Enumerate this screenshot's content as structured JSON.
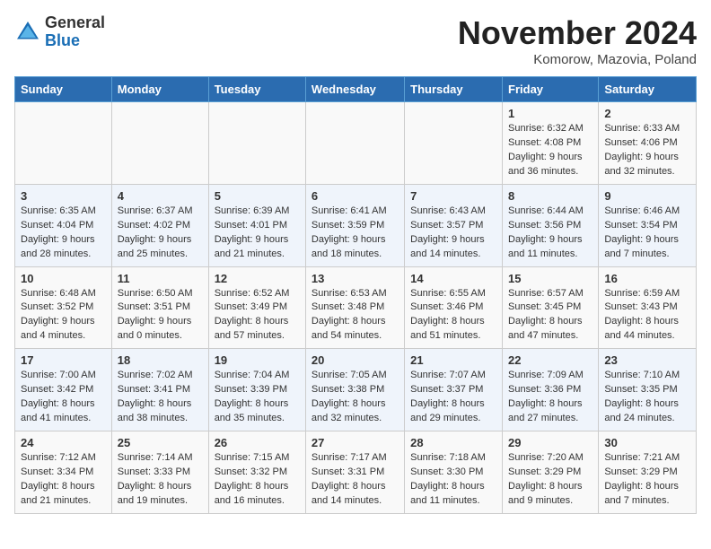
{
  "header": {
    "logo_general": "General",
    "logo_blue": "Blue",
    "month_title": "November 2024",
    "location": "Komorow, Mazovia, Poland"
  },
  "weekdays": [
    "Sunday",
    "Monday",
    "Tuesday",
    "Wednesday",
    "Thursday",
    "Friday",
    "Saturday"
  ],
  "rows": [
    [
      {
        "day": "",
        "info": ""
      },
      {
        "day": "",
        "info": ""
      },
      {
        "day": "",
        "info": ""
      },
      {
        "day": "",
        "info": ""
      },
      {
        "day": "",
        "info": ""
      },
      {
        "day": "1",
        "info": "Sunrise: 6:32 AM\nSunset: 4:08 PM\nDaylight: 9 hours and 36 minutes."
      },
      {
        "day": "2",
        "info": "Sunrise: 6:33 AM\nSunset: 4:06 PM\nDaylight: 9 hours and 32 minutes."
      }
    ],
    [
      {
        "day": "3",
        "info": "Sunrise: 6:35 AM\nSunset: 4:04 PM\nDaylight: 9 hours and 28 minutes."
      },
      {
        "day": "4",
        "info": "Sunrise: 6:37 AM\nSunset: 4:02 PM\nDaylight: 9 hours and 25 minutes."
      },
      {
        "day": "5",
        "info": "Sunrise: 6:39 AM\nSunset: 4:01 PM\nDaylight: 9 hours and 21 minutes."
      },
      {
        "day": "6",
        "info": "Sunrise: 6:41 AM\nSunset: 3:59 PM\nDaylight: 9 hours and 18 minutes."
      },
      {
        "day": "7",
        "info": "Sunrise: 6:43 AM\nSunset: 3:57 PM\nDaylight: 9 hours and 14 minutes."
      },
      {
        "day": "8",
        "info": "Sunrise: 6:44 AM\nSunset: 3:56 PM\nDaylight: 9 hours and 11 minutes."
      },
      {
        "day": "9",
        "info": "Sunrise: 6:46 AM\nSunset: 3:54 PM\nDaylight: 9 hours and 7 minutes."
      }
    ],
    [
      {
        "day": "10",
        "info": "Sunrise: 6:48 AM\nSunset: 3:52 PM\nDaylight: 9 hours and 4 minutes."
      },
      {
        "day": "11",
        "info": "Sunrise: 6:50 AM\nSunset: 3:51 PM\nDaylight: 9 hours and 0 minutes."
      },
      {
        "day": "12",
        "info": "Sunrise: 6:52 AM\nSunset: 3:49 PM\nDaylight: 8 hours and 57 minutes."
      },
      {
        "day": "13",
        "info": "Sunrise: 6:53 AM\nSunset: 3:48 PM\nDaylight: 8 hours and 54 minutes."
      },
      {
        "day": "14",
        "info": "Sunrise: 6:55 AM\nSunset: 3:46 PM\nDaylight: 8 hours and 51 minutes."
      },
      {
        "day": "15",
        "info": "Sunrise: 6:57 AM\nSunset: 3:45 PM\nDaylight: 8 hours and 47 minutes."
      },
      {
        "day": "16",
        "info": "Sunrise: 6:59 AM\nSunset: 3:43 PM\nDaylight: 8 hours and 44 minutes."
      }
    ],
    [
      {
        "day": "17",
        "info": "Sunrise: 7:00 AM\nSunset: 3:42 PM\nDaylight: 8 hours and 41 minutes."
      },
      {
        "day": "18",
        "info": "Sunrise: 7:02 AM\nSunset: 3:41 PM\nDaylight: 8 hours and 38 minutes."
      },
      {
        "day": "19",
        "info": "Sunrise: 7:04 AM\nSunset: 3:39 PM\nDaylight: 8 hours and 35 minutes."
      },
      {
        "day": "20",
        "info": "Sunrise: 7:05 AM\nSunset: 3:38 PM\nDaylight: 8 hours and 32 minutes."
      },
      {
        "day": "21",
        "info": "Sunrise: 7:07 AM\nSunset: 3:37 PM\nDaylight: 8 hours and 29 minutes."
      },
      {
        "day": "22",
        "info": "Sunrise: 7:09 AM\nSunset: 3:36 PM\nDaylight: 8 hours and 27 minutes."
      },
      {
        "day": "23",
        "info": "Sunrise: 7:10 AM\nSunset: 3:35 PM\nDaylight: 8 hours and 24 minutes."
      }
    ],
    [
      {
        "day": "24",
        "info": "Sunrise: 7:12 AM\nSunset: 3:34 PM\nDaylight: 8 hours and 21 minutes."
      },
      {
        "day": "25",
        "info": "Sunrise: 7:14 AM\nSunset: 3:33 PM\nDaylight: 8 hours and 19 minutes."
      },
      {
        "day": "26",
        "info": "Sunrise: 7:15 AM\nSunset: 3:32 PM\nDaylight: 8 hours and 16 minutes."
      },
      {
        "day": "27",
        "info": "Sunrise: 7:17 AM\nSunset: 3:31 PM\nDaylight: 8 hours and 14 minutes."
      },
      {
        "day": "28",
        "info": "Sunrise: 7:18 AM\nSunset: 3:30 PM\nDaylight: 8 hours and 11 minutes."
      },
      {
        "day": "29",
        "info": "Sunrise: 7:20 AM\nSunset: 3:29 PM\nDaylight: 8 hours and 9 minutes."
      },
      {
        "day": "30",
        "info": "Sunrise: 7:21 AM\nSunset: 3:29 PM\nDaylight: 8 hours and 7 minutes."
      }
    ]
  ]
}
